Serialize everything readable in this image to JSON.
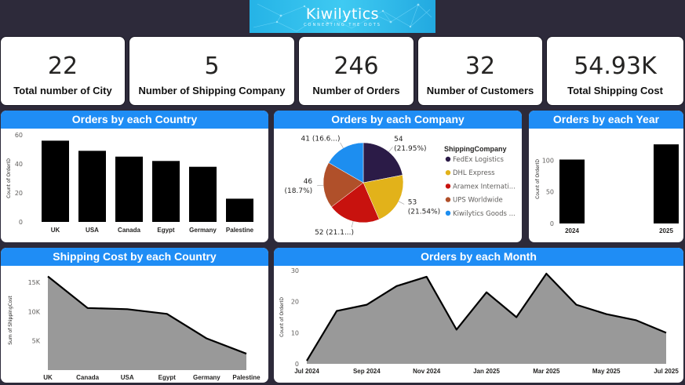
{
  "logo": {
    "title": "Kiwilytics",
    "tagline": "CONNECTING THE DOTS"
  },
  "kpis": [
    {
      "value": "22",
      "label": "Total number of City"
    },
    {
      "value": "5",
      "label": "Number of Shipping Company"
    },
    {
      "value": "246",
      "label": "Number of Orders"
    },
    {
      "value": "32",
      "label": "Number of Customers"
    },
    {
      "value": "54.93K",
      "label": "Total Shipping Cost"
    }
  ],
  "chart_titles": {
    "country": "Orders by each Country",
    "company": "Orders by each Company",
    "year": "Orders by each Year",
    "cost": "Shipping Cost by each Country",
    "month": "Orders by each Month"
  },
  "chart_data": [
    {
      "id": "country",
      "type": "bar",
      "title": "Orders by each Country",
      "ylabel": "Count of OrderID",
      "xlabel": "",
      "categories": [
        "UK",
        "USA",
        "Canada",
        "Egypt",
        "Germany",
        "Palestine"
      ],
      "values": [
        56,
        49,
        45,
        42,
        38,
        16
      ],
      "ylim": [
        0,
        60
      ],
      "yticks": [
        0,
        20,
        40,
        60
      ],
      "color": "#000000"
    },
    {
      "id": "company",
      "type": "pie",
      "title": "Orders by each Company",
      "legend_title": "ShippingCompany",
      "slices": [
        {
          "name": "FedEx Logistics",
          "value": 54,
          "label": "54",
          "pct": "(21.95%)",
          "color": "#2b1b47"
        },
        {
          "name": "DHL Express",
          "value": 53,
          "label": "53",
          "pct": "(21.54%)",
          "color": "#e2b21a"
        },
        {
          "name": "Aramex Internati...",
          "value": 52,
          "label": "52 (21.1...)",
          "pct": "",
          "color": "#c8120e"
        },
        {
          "name": "UPS Worldwide",
          "value": 46,
          "label": "46",
          "pct": "(18.7%)",
          "color": "#b0502a"
        },
        {
          "name": "Kiwilytics Goods ...",
          "value": 41,
          "label": "41 (16.6...)",
          "pct": "",
          "color": "#1d8ef0"
        }
      ]
    },
    {
      "id": "year",
      "type": "bar",
      "title": "Orders by each Year",
      "ylabel": "Count of OrderID",
      "categories": [
        "2024",
        "2025"
      ],
      "values": [
        101,
        125
      ],
      "ylim": [
        0,
        140
      ],
      "yticks": [
        0,
        50,
        100
      ],
      "color": "#000000"
    },
    {
      "id": "cost",
      "type": "area",
      "title": "Shipping Cost by each Country",
      "ylabel": "Sum of ShippingCost",
      "categories": [
        "UK",
        "Canada",
        "USA",
        "Egypt",
        "Germany",
        "Palestine"
      ],
      "values": [
        16000,
        10600,
        10400,
        9600,
        5400,
        2800
      ],
      "ylim": [
        0,
        17000
      ],
      "yticks": [
        5000,
        10000,
        15000
      ],
      "ytick_labels": [
        "5K",
        "10K",
        "15K"
      ]
    },
    {
      "id": "month",
      "type": "area",
      "title": "Orders by each Month",
      "ylabel": "Count of OrderID",
      "categories": [
        "Jul 2024",
        "Aug 2024",
        "Sep 2024",
        "Oct 2024",
        "Nov 2024",
        "Dec 2024",
        "Jan 2025",
        "Feb 2025",
        "Mar 2025",
        "Apr 2025",
        "May 2025",
        "Jun 2025",
        "Jul 2025"
      ],
      "values": [
        1,
        17,
        19,
        25,
        28,
        11,
        23,
        15,
        29,
        19,
        16,
        14,
        10
      ],
      "tick_labels": [
        "Jul 2024",
        "Sep 2024",
        "Nov 2024",
        "Jan 2025",
        "Mar 2025",
        "May 2025",
        "Jul 2025"
      ],
      "tick_indices": [
        0,
        2,
        4,
        6,
        8,
        10,
        12
      ],
      "ylim": [
        0,
        30
      ],
      "yticks": [
        0,
        10,
        20,
        30
      ]
    }
  ]
}
